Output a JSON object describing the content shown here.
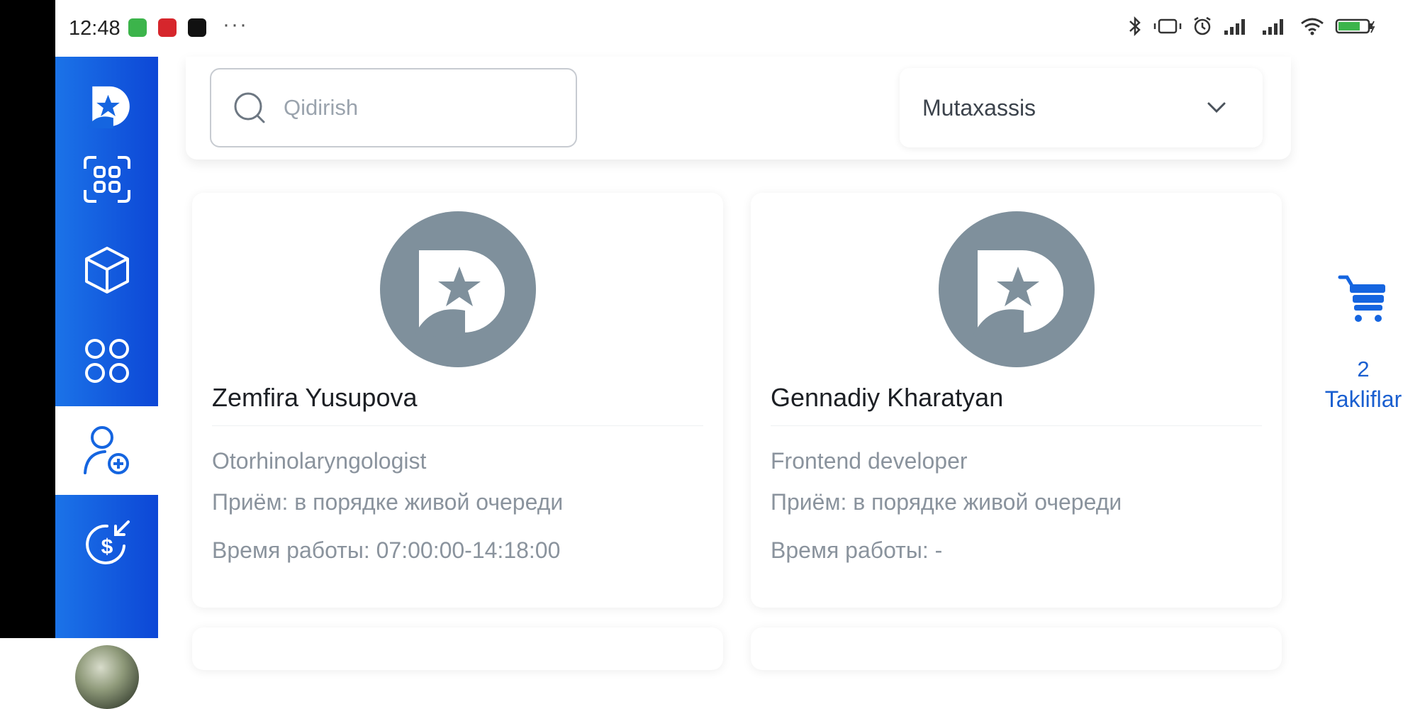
{
  "status_bar": {
    "time": "12:48"
  },
  "search": {
    "placeholder": "Qidirish"
  },
  "filter": {
    "selected": "Mutaxassis"
  },
  "specialists": [
    {
      "name": "Zemfira Yusupova",
      "specialty": "Otorhinolaryngologist",
      "reception": "Приём: в порядке живой очереди",
      "hours": "Время работы: 07:00:00-14:18:00"
    },
    {
      "name": "Gennadiy Kharatyan",
      "specialty": "Frontend developer",
      "reception": "Приём: в порядке живой очереди",
      "hours": "Время работы: -"
    }
  ],
  "cart": {
    "count": "2",
    "label": "Takliflar"
  },
  "sidebar": {
    "items": [
      {
        "icon": "logo-icon"
      },
      {
        "icon": "scan-icon"
      },
      {
        "icon": "cube-icon"
      },
      {
        "icon": "grid-icon"
      },
      {
        "icon": "add-user-icon",
        "active": true
      },
      {
        "icon": "dollar-refund-icon"
      }
    ]
  },
  "colors": {
    "accent": "#1565e0",
    "logo_gray": "#7f909c",
    "muted_text": "#8a939d"
  }
}
